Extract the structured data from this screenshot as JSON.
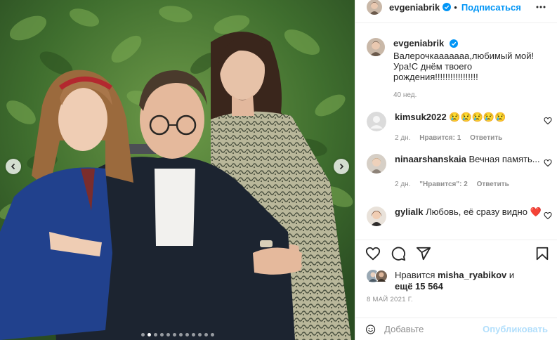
{
  "post": {
    "author": "evgeniabrik",
    "follow_label": "Подписаться",
    "more_icon": "more-horizontal-icon",
    "verified_icon": "verified-badge-icon",
    "photo_description_icon": "family-photo-garden",
    "carousel": {
      "slide_count": 12,
      "active_index": 1
    }
  },
  "caption": {
    "author": "evgeniabrik",
    "text": "Валерочкаааааaa,любимый мой! Ура!С днём твоего рождения!!!!!!!!!!!!!!!!!",
    "age": "40 нед."
  },
  "comments": [
    {
      "user": "kimsuk2022",
      "text": "😢😢😢😢😢",
      "age": "2 дн.",
      "likes": "Нравится: 1",
      "reply": "Ответить"
    },
    {
      "user": "ninaarshanskaia",
      "text": "Вечная память...",
      "age": "2 дн.",
      "likes": "\"Нравится\": 2",
      "reply": "Ответить"
    },
    {
      "user": "gylialk",
      "text": "Любовь, её сразу видно ❤️"
    }
  ],
  "likes": {
    "prefix": "Нравится",
    "user": "misha_ryabikov",
    "suffix": "и",
    "others": "ещё 15 564"
  },
  "date": "8 МАЙ 2021 Г.",
  "add_comment": {
    "placeholder": "Добавьте",
    "publish_label": "Опубликовать"
  },
  "colors": {
    "accent": "#0095f6",
    "publish_disabled": "#b2dffc",
    "secondary_text": "#8e8e8e",
    "heart_red": "#ed4956"
  }
}
